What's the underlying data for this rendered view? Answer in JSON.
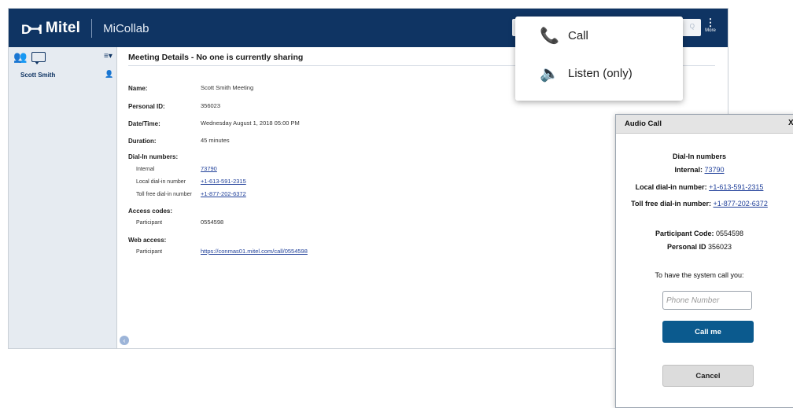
{
  "header": {
    "brand_mark": "DꟷI",
    "brand": "Mitel",
    "product": "MiCollab",
    "more_label": "More",
    "search_hint": "Q"
  },
  "sidebar": {
    "user_name": "Scott Smith",
    "icons": [
      "contacts-icon",
      "chat-icon",
      "menu-icon",
      "presence-icon",
      "collapse-icon"
    ]
  },
  "meeting": {
    "title": "Meeting Details - No one is currently sharing",
    "name_label": "Name:",
    "name_value": "Scott Smith Meeting",
    "personal_id_label": "Personal ID:",
    "personal_id_value": "356023",
    "datetime_label": "Date/Time:",
    "datetime_value": "Wednesday August 1, 2018 05:00 PM",
    "duration_label": "Duration:",
    "duration_value": "45 minutes",
    "dialin_label": "Dial-In numbers:",
    "internal_label": "Internal",
    "internal_value": "73790",
    "local_label": "Local dial-in number",
    "local_value": "+1-613-591-2315",
    "tollfree_label": "Toll free dial-in number",
    "tollfree_value": "+1-877-202-6372",
    "access_label": "Access codes:",
    "participant_label": "Participant",
    "participant_value": "0554598",
    "web_label": "Web access:",
    "web_participant_label": "Participant",
    "web_value": "https://conmas01.mitel.com/call/0554598"
  },
  "popup_menu": {
    "call_label": "Call",
    "listen_label": "Listen (only)"
  },
  "audio_dialog": {
    "title": "Audio Call",
    "close": "X",
    "dialin_heading": "Dial-In numbers",
    "internal_label": "Internal:",
    "internal_value": "73790",
    "local_label": "Local dial-in number:",
    "local_value": "+1-613-591-2315",
    "tollfree_label": "Toll free dial-in number:",
    "tollfree_value": "+1-877-202-6372",
    "participant_code_label": "Participant Code:",
    "participant_code_value": "0554598",
    "personal_id_label": "Personal ID",
    "personal_id_value": "356023",
    "prompt": "To have the system call you:",
    "phone_placeholder": "Phone Number",
    "call_me_label": "Call me",
    "cancel_label": "Cancel"
  },
  "colors": {
    "header_bg": "#0f3463",
    "sidebar_bg": "#e6ebf1",
    "primary_button": "#0b5a8e",
    "link": "#1f3f99"
  }
}
